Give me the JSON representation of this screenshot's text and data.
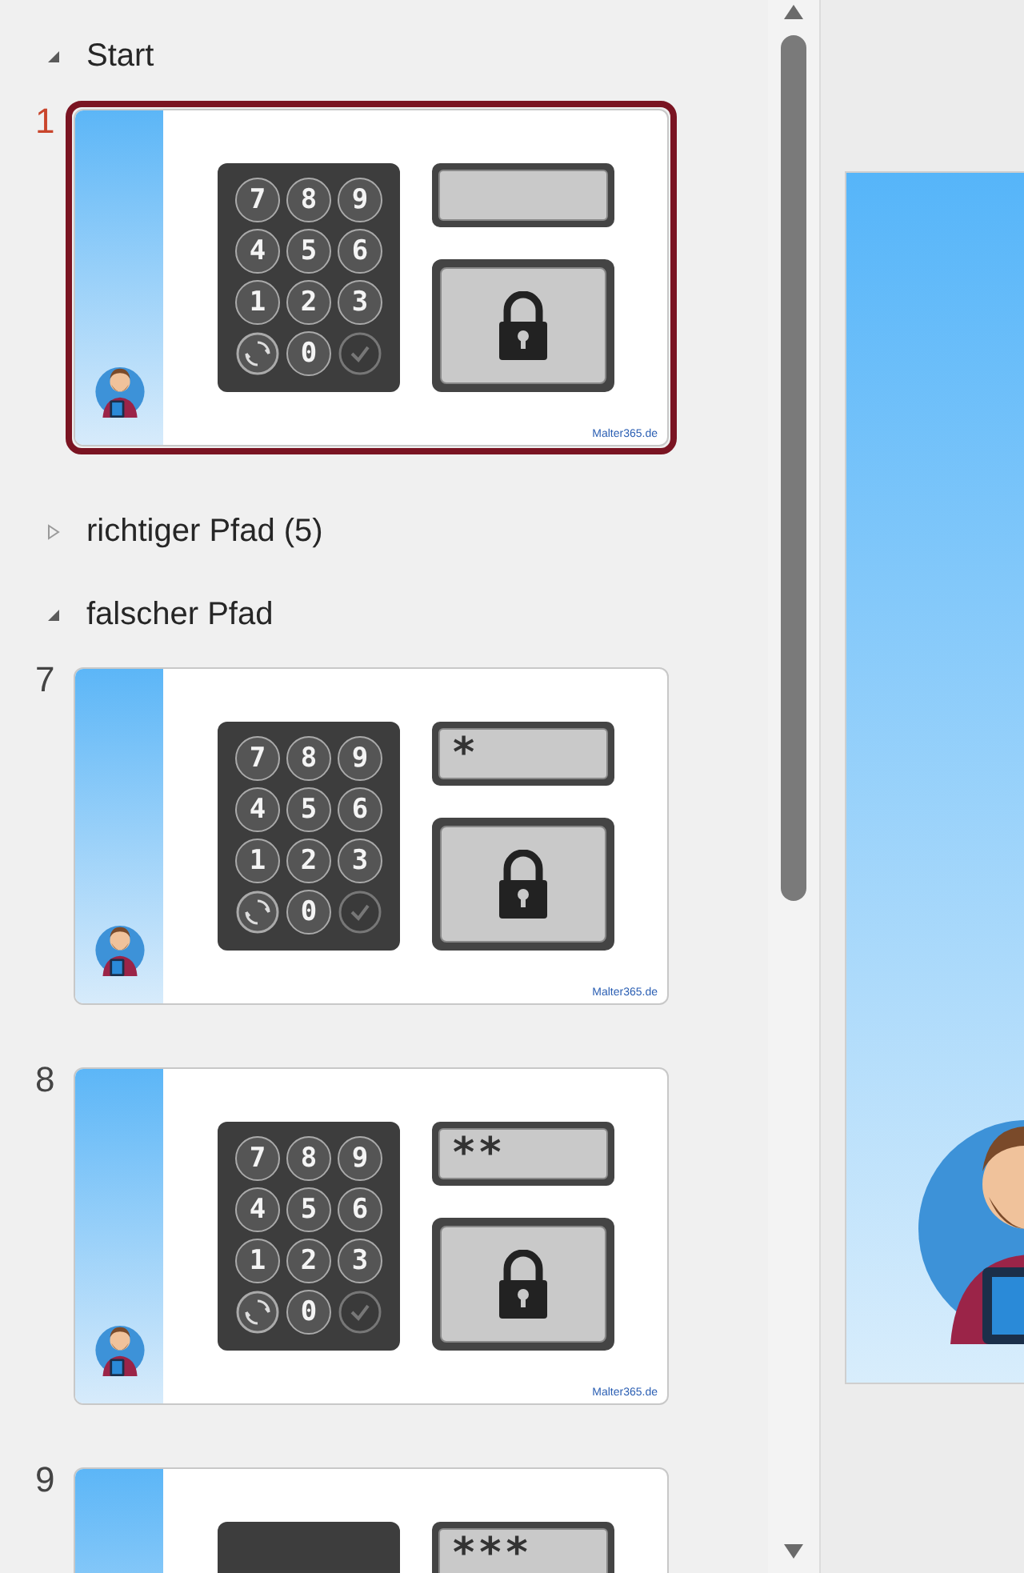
{
  "sections": [
    {
      "title": "Start",
      "expanded": true,
      "slides": [
        {
          "number": "1",
          "selected": true,
          "keys": [
            {
              "kind": "digit",
              "label": "7"
            },
            {
              "kind": "digit",
              "label": "8"
            },
            {
              "kind": "digit",
              "label": "9"
            },
            {
              "kind": "digit",
              "label": "4"
            },
            {
              "kind": "digit",
              "label": "5"
            },
            {
              "kind": "digit",
              "label": "6"
            },
            {
              "kind": "digit",
              "label": "1"
            },
            {
              "kind": "digit",
              "label": "2"
            },
            {
              "kind": "digit",
              "label": "3"
            },
            {
              "kind": "reset"
            },
            {
              "kind": "digit",
              "label": "0"
            },
            {
              "kind": "confirm"
            }
          ],
          "footer": "Malter365.de"
        }
      ]
    },
    {
      "title": "richtiger Pfad (5)",
      "expanded": false
    },
    {
      "title": "falscher Pfad",
      "expanded": true,
      "slides": [
        {
          "number": "7",
          "selected": false,
          "display": "*",
          "keys": [
            {
              "kind": "digit",
              "label": "7"
            },
            {
              "kind": "digit",
              "label": "8"
            },
            {
              "kind": "digit",
              "label": "9"
            },
            {
              "kind": "digit",
              "label": "4"
            },
            {
              "kind": "digit",
              "label": "5"
            },
            {
              "kind": "digit",
              "label": "6"
            },
            {
              "kind": "digit",
              "label": "1"
            },
            {
              "kind": "digit",
              "label": "2"
            },
            {
              "kind": "digit",
              "label": "3"
            },
            {
              "kind": "reset"
            },
            {
              "kind": "digit",
              "label": "0"
            },
            {
              "kind": "confirm"
            }
          ],
          "footer": "Malter365.de"
        },
        {
          "number": "8",
          "selected": false,
          "display": "**",
          "keys": [
            {
              "kind": "digit",
              "label": "7"
            },
            {
              "kind": "digit",
              "label": "8"
            },
            {
              "kind": "digit",
              "label": "9"
            },
            {
              "kind": "digit",
              "label": "4"
            },
            {
              "kind": "digit",
              "label": "5"
            },
            {
              "kind": "digit",
              "label": "6"
            },
            {
              "kind": "digit",
              "label": "1"
            },
            {
              "kind": "digit",
              "label": "2"
            },
            {
              "kind": "digit",
              "label": "3"
            },
            {
              "kind": "reset"
            },
            {
              "kind": "digit",
              "label": "0"
            },
            {
              "kind": "confirm"
            }
          ],
          "footer": "Malter365.de"
        },
        {
          "number": "9",
          "selected": false,
          "display": "***"
        }
      ]
    }
  ]
}
